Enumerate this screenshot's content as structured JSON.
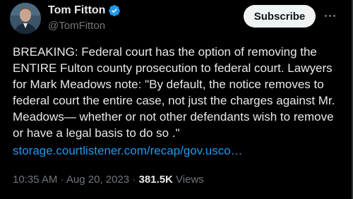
{
  "author": {
    "name": "Tom Fitton",
    "handle": "@TomFitton",
    "avatar": "person-photo"
  },
  "actions": {
    "subscribe_label": "Subscribe",
    "more_icon": "more-horizontal-icon"
  },
  "tweet": {
    "text": "BREAKING: Federal court has the option of removing the\nENTIRE Fulton county prosecution to federal court. Lawyers\nfor Mark Meadows note: \"By default, the notice removes to\nfederal court the entire case, not just the charges against Mr.\nMeadows— whether or not other defendants wish to remove\nor have a legal basis to do so .\"",
    "link": "storage.courtlistener.com/recap/gov.usco…"
  },
  "meta": {
    "time": "10:35 AM",
    "separator": " · ",
    "date": "Aug 20, 2023",
    "views_count": "381.5K",
    "views_label": " Views"
  },
  "colors": {
    "background": "#000000",
    "text": "#e7e9ea",
    "secondary": "#71767b",
    "link": "#1d9bf0",
    "verified": "#1d9bf0",
    "subscribe_bg": "#eff3f4"
  }
}
